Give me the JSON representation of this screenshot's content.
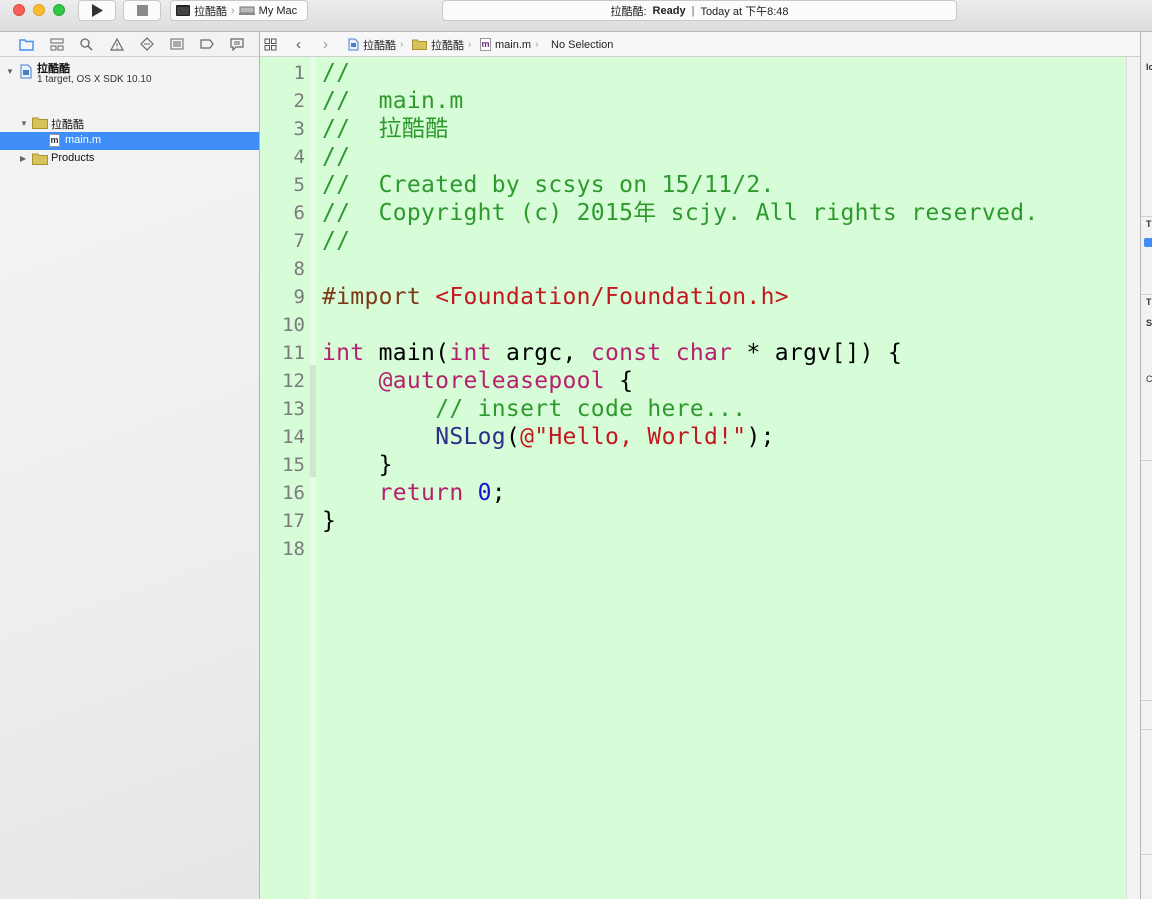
{
  "toolbar": {
    "scheme_target": "拉酷酷",
    "scheme_destination": "My Mac",
    "activity_project": "拉酷酷:",
    "activity_status": "Ready",
    "activity_time": "Today at 下午8:48"
  },
  "navigator": {
    "tabs": [
      "folder-icon",
      "hierarchy-icon",
      "search-icon",
      "warning-icon",
      "test-icon",
      "debug-icon",
      "breakpoint-icon",
      "report-icon"
    ],
    "project_name": "拉酷酷",
    "project_subtitle": "1 target, OS X SDK 10.10",
    "group_name": "拉酷酷",
    "selected_file": "main.m",
    "products_group": "Products"
  },
  "jumpbar": {
    "crumbs": [
      "拉酷酷",
      "拉酷酷",
      "main.m",
      "No Selection"
    ]
  },
  "editor": {
    "lines": [
      {
        "n": "1",
        "text": "//"
      },
      {
        "n": "2",
        "text": "//  main.m"
      },
      {
        "n": "3",
        "text": "//  拉酷酷"
      },
      {
        "n": "4",
        "text": "//"
      },
      {
        "n": "5",
        "text": "//  Created by scsys on 15/11/2."
      },
      {
        "n": "6",
        "text": "//  Copyright (c) 2015年 scjy. All rights reserved."
      },
      {
        "n": "7",
        "text": "//"
      },
      {
        "n": "8",
        "text": ""
      },
      {
        "n": "9",
        "text": "#import <Foundation/Foundation.h>"
      },
      {
        "n": "10",
        "text": ""
      },
      {
        "n": "11",
        "text": "int main(int argc, const char * argv[]) {"
      },
      {
        "n": "12",
        "text": "    @autoreleasepool {"
      },
      {
        "n": "13",
        "text": "        // insert code here..."
      },
      {
        "n": "14",
        "text": "        NSLog(@\"Hello, World!\");"
      },
      {
        "n": "15",
        "text": "    }"
      },
      {
        "n": "16",
        "text": "    return 0;"
      },
      {
        "n": "17",
        "text": "}"
      },
      {
        "n": "18",
        "text": ""
      }
    ]
  },
  "inspector": {
    "labels": [
      "Ic",
      "T",
      "T",
      "S",
      "C"
    ]
  },
  "colors": {
    "editor_background": "#d6fcd8",
    "selection": "#3f8ef8",
    "comment": "#2e9a2e",
    "keyword": "#b7206e",
    "string": "#c2181e",
    "number": "#1c10d2"
  }
}
